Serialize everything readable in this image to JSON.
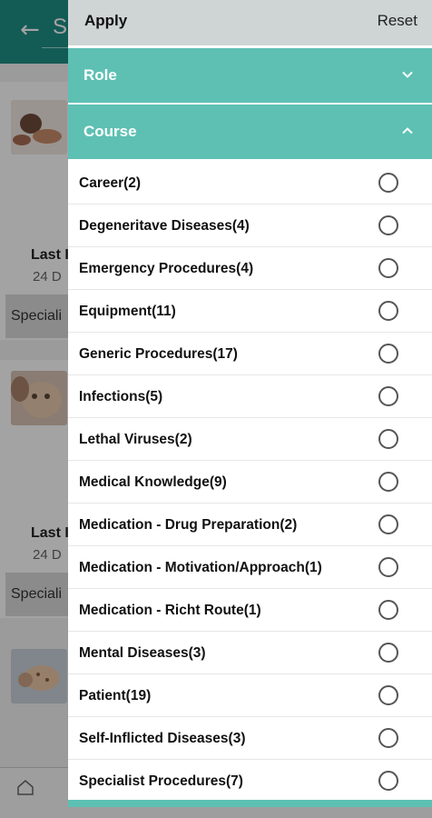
{
  "background": {
    "header_title": "S",
    "cards": [
      {
        "last_label": "Last I",
        "date": "24 D",
        "tag": "Speciali"
      },
      {
        "last_label": "Last I",
        "date": "24 D",
        "tag": "Speciali"
      }
    ]
  },
  "drawer": {
    "apply_label": "Apply",
    "reset_label": "Reset",
    "sections": {
      "role": {
        "label": "Role",
        "expanded": false
      },
      "course": {
        "label": "Course",
        "expanded": true
      }
    },
    "course_items": [
      {
        "label": "Career(2)",
        "selected": false
      },
      {
        "label": "Degeneritave Diseases(4)",
        "selected": false
      },
      {
        "label": "Emergency Procedures(4)",
        "selected": false
      },
      {
        "label": "Equipment(11)",
        "selected": false
      },
      {
        "label": "Generic Procedures(17)",
        "selected": false
      },
      {
        "label": "Infections(5)",
        "selected": false
      },
      {
        "label": "Lethal Viruses(2)",
        "selected": false
      },
      {
        "label": "Medical Knowledge(9)",
        "selected": false
      },
      {
        "label": "Medication - Drug Preparation(2)",
        "selected": false
      },
      {
        "label": "Medication - Motivation/Approach(1)",
        "selected": false
      },
      {
        "label": "Medication - Richt Route(1)",
        "selected": false
      },
      {
        "label": "Mental Diseases(3)",
        "selected": false
      },
      {
        "label": "Patient(19)",
        "selected": false
      },
      {
        "label": "Self-Inflicted Diseases(3)",
        "selected": false
      },
      {
        "label": "Specialist Procedures(7)",
        "selected": false
      }
    ]
  },
  "colors": {
    "primary_dark": "#1f8f86",
    "section_teal": "#5dc0b3",
    "drawer_header": "#ced5d4"
  }
}
